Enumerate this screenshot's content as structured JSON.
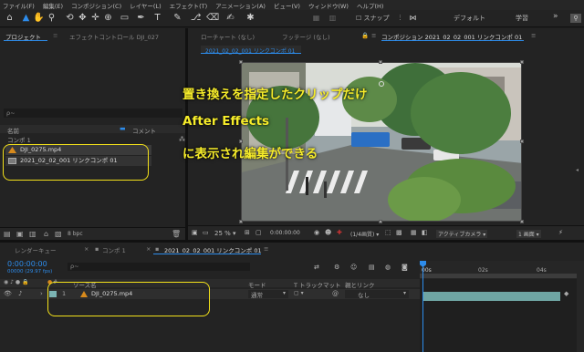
{
  "menu": [
    "ファイル(F)",
    "編集(E)",
    "コンポジション(C)",
    "レイヤー(L)",
    "エフェクト(T)",
    "アニメーション(A)",
    "ビュー(V)",
    "ウィンドウ(W)",
    "ヘルプ(H)"
  ],
  "toolbar": {
    "snap_label": "スナップ",
    "workspace_default": "デフォルト",
    "workspace_learn": "学習",
    "more": "»"
  },
  "project_panel": {
    "tab_project": "プロジェクト",
    "tab_effect_controls": "エフェクトコントロール DJI_027",
    "search_placeholder": "ρ~",
    "col_name": "名前",
    "col_comment": "コメント",
    "items": [
      {
        "name": "コンポ 1",
        "type": "comp"
      },
      {
        "name": "DJI_0275.mp4",
        "type": "video"
      },
      {
        "name": "2021_02_02_001 リンクコンポ 01",
        "type": "comp"
      }
    ],
    "bpc": "8 bpc"
  },
  "viewer": {
    "tab_footage_prefix": "ローチャート (なし)",
    "tab_footage": "フッテージ (なし)",
    "tab_comp": "コンポジション 2021_02_02_001 リンクコンポ 01",
    "comp_label": "2021_02_02_001 リンクコンポ 01",
    "zoom": "25 %",
    "timecode": "0:00:00:00",
    "resolution": "(1/4画質)",
    "camera": "アクティブカメラ",
    "view": "1 画面"
  },
  "annotation": {
    "line1": "置き換えを指定したクリップだけ",
    "line2": "After Effects",
    "line3": "に表示され編集ができる"
  },
  "timeline": {
    "tab_render_queue": "レンダーキュー",
    "tab_comp1": "コンポ 1",
    "tab_linkcomp": "2021_02_02_001 リンクコンポ 01",
    "current_time": "0:00:00:00",
    "frame_info": "00000 (29.97 fps)",
    "col_source": "ソース名",
    "col_mode": "モード",
    "col_trackmatte": "T トラックマット",
    "col_parent": "親とリンク",
    "ruler_marks": [
      "00s",
      "02s",
      "04s"
    ],
    "layers": [
      {
        "index": "1",
        "name": "DJI_0275.mp4",
        "mode": "通常",
        "parent": "なし"
      }
    ]
  },
  "colors": {
    "accent": "#2d8ceb",
    "callout": "#f3e11a",
    "annotation_text": "#f6ec2a",
    "layer_bar": "#6fa5a3"
  }
}
